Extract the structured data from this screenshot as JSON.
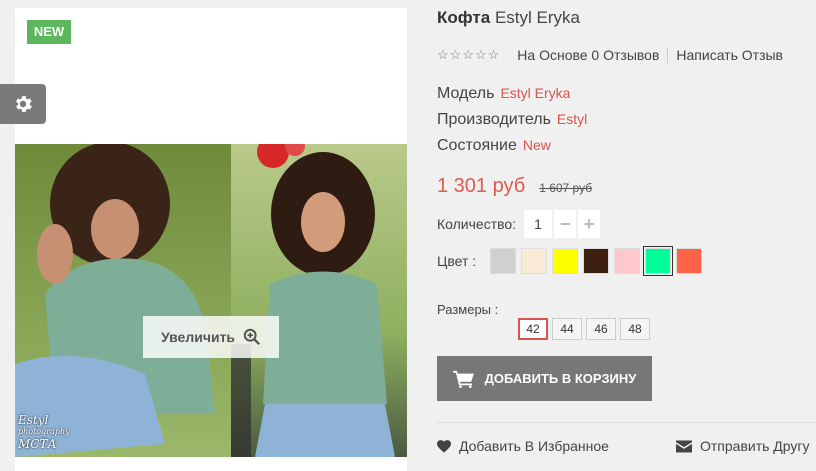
{
  "product": {
    "title_main": "Кофта",
    "title_brand": "Estyl Eryka",
    "badge": "NEW",
    "zoom_label": "Увеличить",
    "watermark_line1": "Estyl",
    "watermark_line2": "photography",
    "watermark_line3": "МСТА"
  },
  "rating": {
    "stars_filled": 0,
    "stars_total": 5,
    "reviews_text": "На Основе 0 Отзывов",
    "write_review": "Написать Отзыв"
  },
  "meta": [
    {
      "label": "Модель",
      "value": "Estyl Eryka"
    },
    {
      "label": "Производитель",
      "value": "Estyl"
    },
    {
      "label": "Состояние",
      "value": "New"
    }
  ],
  "price": {
    "current": "1 301 руб",
    "old": "1 607 руб"
  },
  "quantity": {
    "label": "Количество:",
    "value": "1",
    "minus": "−",
    "plus": "+"
  },
  "color": {
    "label": "Цвет :",
    "swatches": [
      "#d0d0d0",
      "#faebd7",
      "#ffff00",
      "#3d1f10",
      "#ffc8cd",
      "#00ff99",
      "#ff6347"
    ],
    "selected_index": 5
  },
  "sizes": {
    "label": "Размеры :",
    "options": [
      "42",
      "44",
      "46",
      "48"
    ],
    "selected": "42"
  },
  "actions": {
    "add_to_cart": "ДОБАВИТЬ В КОРЗИНУ",
    "wishlist": "Добавить В Избранное",
    "send_friend": "Отправить Другу"
  },
  "icons": {
    "settings": "gear-icon",
    "zoom": "zoom-in-icon",
    "cart": "cart-icon",
    "heart": "heart-icon",
    "mail": "envelope-icon"
  }
}
